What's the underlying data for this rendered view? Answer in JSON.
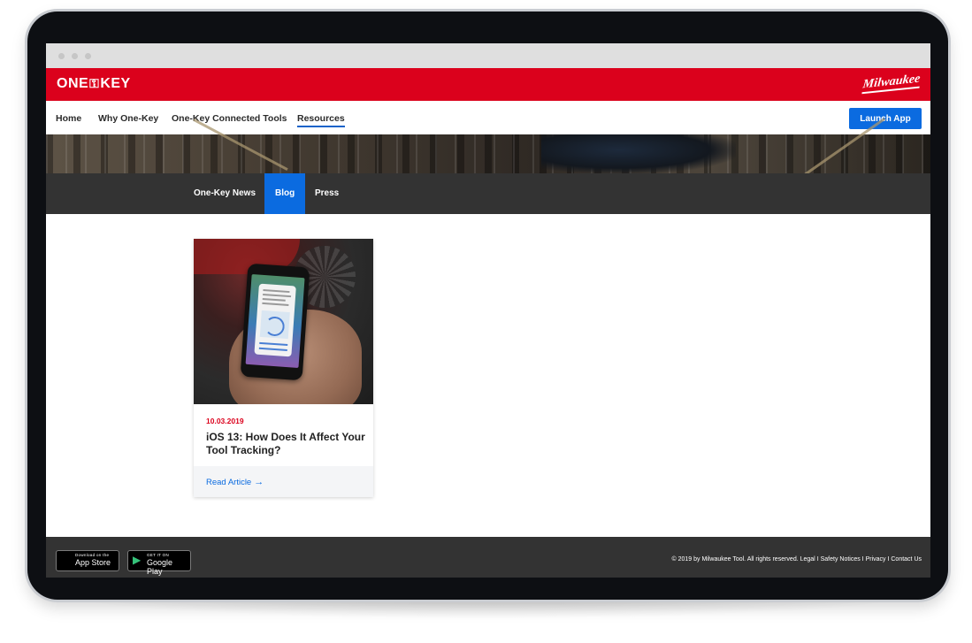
{
  "brand": {
    "logo_left": "ONE",
    "logo_right": "KEY",
    "logo_partner": "Milwaukee"
  },
  "nav": {
    "items": [
      {
        "label": "Home"
      },
      {
        "label": "Why One-Key"
      },
      {
        "label": "One-Key Connected Tools"
      },
      {
        "label": "Resources",
        "active": true
      }
    ],
    "cta": "Launch App"
  },
  "subnav": {
    "items": [
      {
        "label": "One-Key News"
      },
      {
        "label": "Blog",
        "active": true
      },
      {
        "label": "Press"
      }
    ]
  },
  "article": {
    "date": "10.03.2019",
    "title": "iOS 13: How Does It Affect Your Tool Tracking?",
    "read_label": "Read Article",
    "arrow": "→"
  },
  "footer": {
    "app_store": {
      "small": "Download on the",
      "big": "App Store"
    },
    "google_play": {
      "small": "GET IT ON",
      "big": "Google Play"
    },
    "copyright": "© 2019 by Milwaukee Tool. All rights reserved.",
    "links": [
      "Legal",
      "Safety Notices",
      "Privacy",
      "Contact Us"
    ],
    "separator": " I "
  },
  "colors": {
    "brand_red": "#db011c",
    "accent_blue": "#0b6be0",
    "dark_bar": "#333333"
  }
}
